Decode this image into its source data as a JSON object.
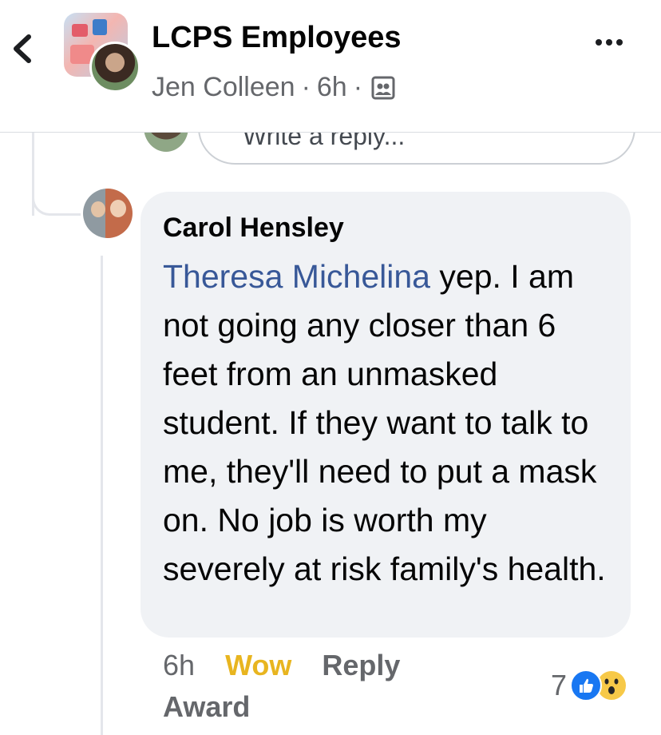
{
  "header": {
    "group_title": "LCPS Employees",
    "author_name": "Jen Colleen",
    "separator": "·",
    "post_age": "6h",
    "icons": [
      "back-chevron-icon",
      "group-avatar",
      "user-avatar",
      "privacy-icon",
      "more-icon"
    ]
  },
  "reply_input": {
    "placeholder": "Write a reply..."
  },
  "comment": {
    "author": "Carol Hensley",
    "mention": "Theresa Michelina",
    "body": " yep. I am not going any closer than 6 feet from an unmasked student. If they want to talk to me, they'll need to put a mask on. No job is worth my severely at risk family's health.",
    "age": "6h",
    "reaction_action": "Wow",
    "reply_action": "Reply",
    "award_action": "Award",
    "reaction_count": "7",
    "reaction_icons": [
      "like-icon",
      "wow-icon"
    ]
  },
  "colors": {
    "mention": "#385898",
    "wow_label": "#e8b520",
    "bubble": "#f0f2f5",
    "secondary_text": "#65676b",
    "like": "#1877f2"
  }
}
